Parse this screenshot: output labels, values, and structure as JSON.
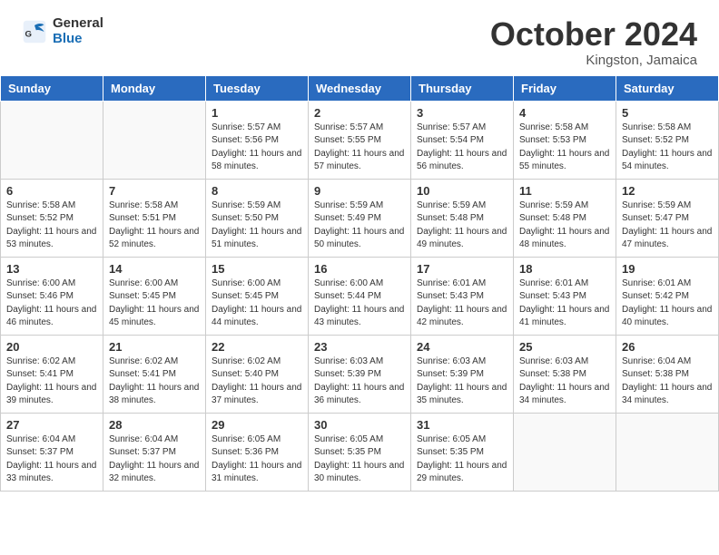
{
  "header": {
    "logo_general": "General",
    "logo_blue": "Blue",
    "month_title": "October 2024",
    "location": "Kingston, Jamaica"
  },
  "weekdays": [
    "Sunday",
    "Monday",
    "Tuesday",
    "Wednesday",
    "Thursday",
    "Friday",
    "Saturday"
  ],
  "weeks": [
    [
      {
        "day": "",
        "info": ""
      },
      {
        "day": "",
        "info": ""
      },
      {
        "day": "1",
        "info": "Sunrise: 5:57 AM\nSunset: 5:56 PM\nDaylight: 11 hours and 58 minutes."
      },
      {
        "day": "2",
        "info": "Sunrise: 5:57 AM\nSunset: 5:55 PM\nDaylight: 11 hours and 57 minutes."
      },
      {
        "day": "3",
        "info": "Sunrise: 5:57 AM\nSunset: 5:54 PM\nDaylight: 11 hours and 56 minutes."
      },
      {
        "day": "4",
        "info": "Sunrise: 5:58 AM\nSunset: 5:53 PM\nDaylight: 11 hours and 55 minutes."
      },
      {
        "day": "5",
        "info": "Sunrise: 5:58 AM\nSunset: 5:52 PM\nDaylight: 11 hours and 54 minutes."
      }
    ],
    [
      {
        "day": "6",
        "info": "Sunrise: 5:58 AM\nSunset: 5:52 PM\nDaylight: 11 hours and 53 minutes."
      },
      {
        "day": "7",
        "info": "Sunrise: 5:58 AM\nSunset: 5:51 PM\nDaylight: 11 hours and 52 minutes."
      },
      {
        "day": "8",
        "info": "Sunrise: 5:59 AM\nSunset: 5:50 PM\nDaylight: 11 hours and 51 minutes."
      },
      {
        "day": "9",
        "info": "Sunrise: 5:59 AM\nSunset: 5:49 PM\nDaylight: 11 hours and 50 minutes."
      },
      {
        "day": "10",
        "info": "Sunrise: 5:59 AM\nSunset: 5:48 PM\nDaylight: 11 hours and 49 minutes."
      },
      {
        "day": "11",
        "info": "Sunrise: 5:59 AM\nSunset: 5:48 PM\nDaylight: 11 hours and 48 minutes."
      },
      {
        "day": "12",
        "info": "Sunrise: 5:59 AM\nSunset: 5:47 PM\nDaylight: 11 hours and 47 minutes."
      }
    ],
    [
      {
        "day": "13",
        "info": "Sunrise: 6:00 AM\nSunset: 5:46 PM\nDaylight: 11 hours and 46 minutes."
      },
      {
        "day": "14",
        "info": "Sunrise: 6:00 AM\nSunset: 5:45 PM\nDaylight: 11 hours and 45 minutes."
      },
      {
        "day": "15",
        "info": "Sunrise: 6:00 AM\nSunset: 5:45 PM\nDaylight: 11 hours and 44 minutes."
      },
      {
        "day": "16",
        "info": "Sunrise: 6:00 AM\nSunset: 5:44 PM\nDaylight: 11 hours and 43 minutes."
      },
      {
        "day": "17",
        "info": "Sunrise: 6:01 AM\nSunset: 5:43 PM\nDaylight: 11 hours and 42 minutes."
      },
      {
        "day": "18",
        "info": "Sunrise: 6:01 AM\nSunset: 5:43 PM\nDaylight: 11 hours and 41 minutes."
      },
      {
        "day": "19",
        "info": "Sunrise: 6:01 AM\nSunset: 5:42 PM\nDaylight: 11 hours and 40 minutes."
      }
    ],
    [
      {
        "day": "20",
        "info": "Sunrise: 6:02 AM\nSunset: 5:41 PM\nDaylight: 11 hours and 39 minutes."
      },
      {
        "day": "21",
        "info": "Sunrise: 6:02 AM\nSunset: 5:41 PM\nDaylight: 11 hours and 38 minutes."
      },
      {
        "day": "22",
        "info": "Sunrise: 6:02 AM\nSunset: 5:40 PM\nDaylight: 11 hours and 37 minutes."
      },
      {
        "day": "23",
        "info": "Sunrise: 6:03 AM\nSunset: 5:39 PM\nDaylight: 11 hours and 36 minutes."
      },
      {
        "day": "24",
        "info": "Sunrise: 6:03 AM\nSunset: 5:39 PM\nDaylight: 11 hours and 35 minutes."
      },
      {
        "day": "25",
        "info": "Sunrise: 6:03 AM\nSunset: 5:38 PM\nDaylight: 11 hours and 34 minutes."
      },
      {
        "day": "26",
        "info": "Sunrise: 6:04 AM\nSunset: 5:38 PM\nDaylight: 11 hours and 34 minutes."
      }
    ],
    [
      {
        "day": "27",
        "info": "Sunrise: 6:04 AM\nSunset: 5:37 PM\nDaylight: 11 hours and 33 minutes."
      },
      {
        "day": "28",
        "info": "Sunrise: 6:04 AM\nSunset: 5:37 PM\nDaylight: 11 hours and 32 minutes."
      },
      {
        "day": "29",
        "info": "Sunrise: 6:05 AM\nSunset: 5:36 PM\nDaylight: 11 hours and 31 minutes."
      },
      {
        "day": "30",
        "info": "Sunrise: 6:05 AM\nSunset: 5:35 PM\nDaylight: 11 hours and 30 minutes."
      },
      {
        "day": "31",
        "info": "Sunrise: 6:05 AM\nSunset: 5:35 PM\nDaylight: 11 hours and 29 minutes."
      },
      {
        "day": "",
        "info": ""
      },
      {
        "day": "",
        "info": ""
      }
    ]
  ]
}
